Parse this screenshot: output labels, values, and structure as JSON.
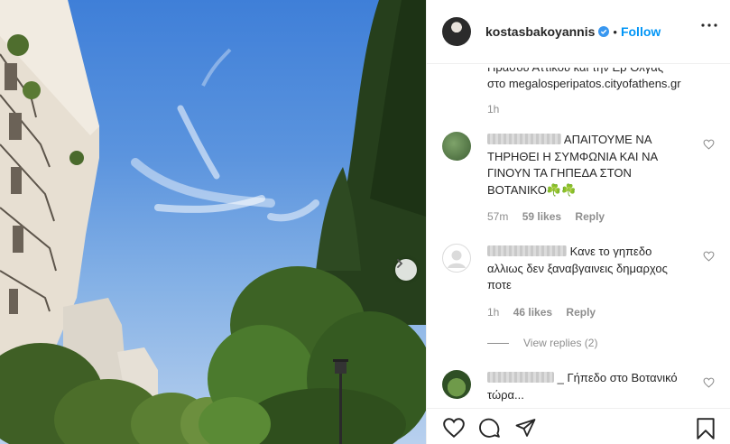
{
  "post": {
    "username": "kostasbakoyannis",
    "follow_label": "Follow",
    "separator": "•"
  },
  "caption_tail": {
    "line1": "Πράσου Αττικού και την Ερ Ολγας",
    "line2": "στο megalosperipatos.cityofathens.gr",
    "time": "1h"
  },
  "comments": [
    {
      "text": "ΑΠΑΙΤΟΥΜΕ ΝΑ ΤΗΡΗΘΕΙ Η ΣΥΜΦΩΝΙΑ ΚΑΙ ΝΑ ΓΙΝΟΥΝ ΤΑ ΓΗΠΕΔΑ ΣΤΟΝ ΒΟΤΑΝΙΚΟ☘️☘️",
      "time": "57m",
      "likes": "59 likes",
      "reply": "Reply"
    },
    {
      "text": "Κανε το γηπεδο αλλιως δεν ξαναβγαινεις δημαρχος ποτε",
      "time": "1h",
      "likes": "46 likes",
      "reply": "Reply"
    },
    {
      "text": "_ Γήπεδο στο Βοτανικό τώρα...",
      "time": "",
      "likes": "",
      "reply": ""
    }
  ],
  "view_replies": "View replies (2)",
  "icons": {
    "carousel_next": "chevron-right-icon",
    "verified": "verified-badge-icon",
    "more": "more-options-icon",
    "like": "heart-icon",
    "comment": "comment-icon",
    "share": "paper-plane-icon",
    "save": "bookmark-icon"
  },
  "colors": {
    "accent": "#0095f6",
    "muted": "#8e8e8e",
    "text": "#262626"
  }
}
